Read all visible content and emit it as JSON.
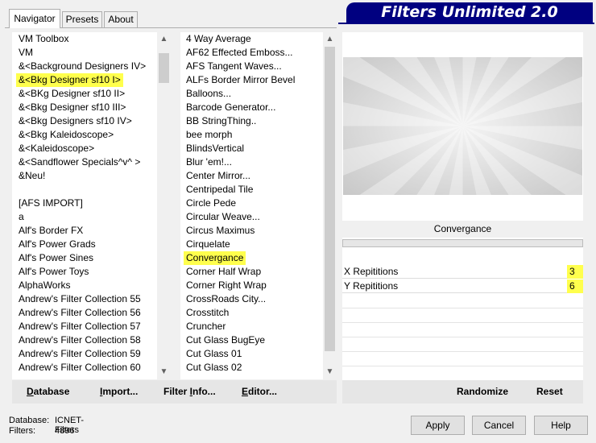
{
  "title": "Filters Unlimited 2.0",
  "tabs": [
    "Navigator",
    "Presets",
    "About"
  ],
  "categories": [
    "VM Toolbox",
    "VM",
    "&<Background Designers IV>",
    "&<Bkg Designer sf10 I>",
    "&<BKg Designer sf10 II>",
    "&<Bkg Designer sf10 III>",
    "&<Bkg Designers sf10 IV>",
    "&<Bkg Kaleidoscope>",
    "&<Kaleidoscope>",
    "&<Sandflower Specials^v^ >",
    "&Neu!",
    "",
    "[AFS IMPORT]",
    "a",
    "Alf's Border FX",
    "Alf's Power Grads",
    "Alf's Power Sines",
    "Alf's Power Toys",
    "AlphaWorks",
    "Andrew's Filter Collection 55",
    "Andrew's Filter Collection 56",
    "Andrew's Filter Collection 57",
    "Andrew's Filter Collection 58",
    "Andrew's Filter Collection 59",
    "Andrew's Filter Collection 60"
  ],
  "selected_category_index": 3,
  "filters": [
    "4 Way Average",
    "AF62 Effected Emboss...",
    "AFS Tangent Waves...",
    "ALFs Border Mirror Bevel",
    "Balloons...",
    "Barcode Generator...",
    "BB StringThing..",
    "bee morph",
    "BlindsVertical",
    "Blur 'em!...",
    "Center Mirror...",
    "Centripedal Tile",
    "Circle Pede",
    "Circular Weave...",
    "Circus Maximus",
    "Cirquelate",
    "Convergance",
    "Corner Half Wrap",
    "Corner Right Wrap",
    "CrossRoads City...",
    "Crosstitch",
    "Cruncher",
    "Cut Glass  BugEye",
    "Cut Glass 01",
    "Cut Glass 02"
  ],
  "selected_filter_index": 16,
  "current_filter": "Convergance",
  "params": [
    {
      "label": "X Repititions",
      "value": "3"
    },
    {
      "label": "Y Repititions",
      "value": "6"
    }
  ],
  "left_buttons": [
    {
      "label": "Database",
      "underline": "D",
      "rest": "atabase"
    },
    {
      "label": "Import...",
      "underline": "I",
      "rest": "mport..."
    },
    {
      "label": "Filter Info...",
      "pre": "Filter ",
      "underline": "I",
      "rest": "nfo..."
    },
    {
      "label": "Editor...",
      "underline": "E",
      "rest": "ditor..."
    }
  ],
  "right_buttons": [
    "Randomize",
    "Reset"
  ],
  "dialog_buttons": [
    "Apply",
    "Cancel",
    "Help"
  ],
  "status": {
    "db_label": "Database:",
    "db_value": "ICNET-Filters",
    "filters_label": "Filters:",
    "filters_value": "4896"
  },
  "icons": {
    "scroll_up": "chevron-up-icon",
    "scroll_down": "chevron-down-icon"
  }
}
